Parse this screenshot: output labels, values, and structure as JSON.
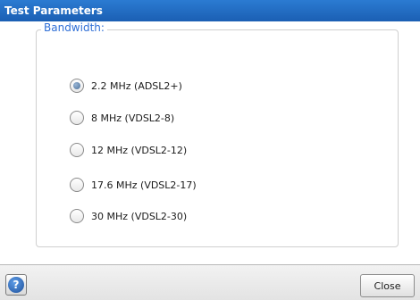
{
  "window": {
    "title": "Test Parameters"
  },
  "bandwidth": {
    "label": "Bandwidth:",
    "selected_index": 0,
    "options": [
      {
        "label": "2.2 MHz (ADSL2+)",
        "checked": true
      },
      {
        "label": "8 MHz (VDSL2-8)",
        "checked": false
      },
      {
        "label": "12 MHz (VDSL2-12)",
        "checked": false
      },
      {
        "label": "17.6 MHz (VDSL2-17)",
        "checked": false
      },
      {
        "label": "30 MHz (VDSL2-30)",
        "checked": false
      }
    ]
  },
  "footer": {
    "help_icon": "question-mark-icon",
    "help_glyph": "?",
    "close_label": "Close"
  },
  "colors": {
    "titlebar": "#1b5fb3",
    "legend_text": "#2f6fd6"
  }
}
